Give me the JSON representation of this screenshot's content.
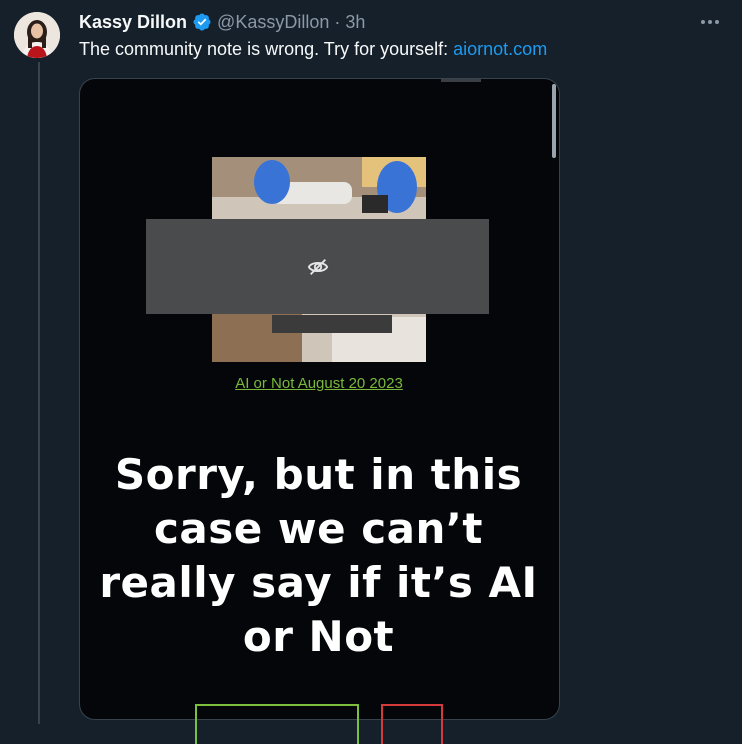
{
  "tweet": {
    "author_name": "Kassy Dillon",
    "handle": "@KassyDillon",
    "separator": "·",
    "time": "3h",
    "text": "The community note is wrong. Try for yourself: ",
    "link_text": "aiornot.com"
  },
  "media": {
    "caption_link": "AI or Not August 20 2023",
    "headline": "Sorry, but in this case we can’t really say if it’s AI or Not"
  },
  "icons": {
    "verified": "verified-badge-icon",
    "more": "more-options-icon",
    "hidden": "eye-slash-icon"
  },
  "colors": {
    "background": "#15202b",
    "link": "#1d9bf0",
    "verified": "#1d9bf0",
    "caption": "#79b83a",
    "button_green": "#7bbf3c",
    "button_red": "#d43a3a"
  }
}
